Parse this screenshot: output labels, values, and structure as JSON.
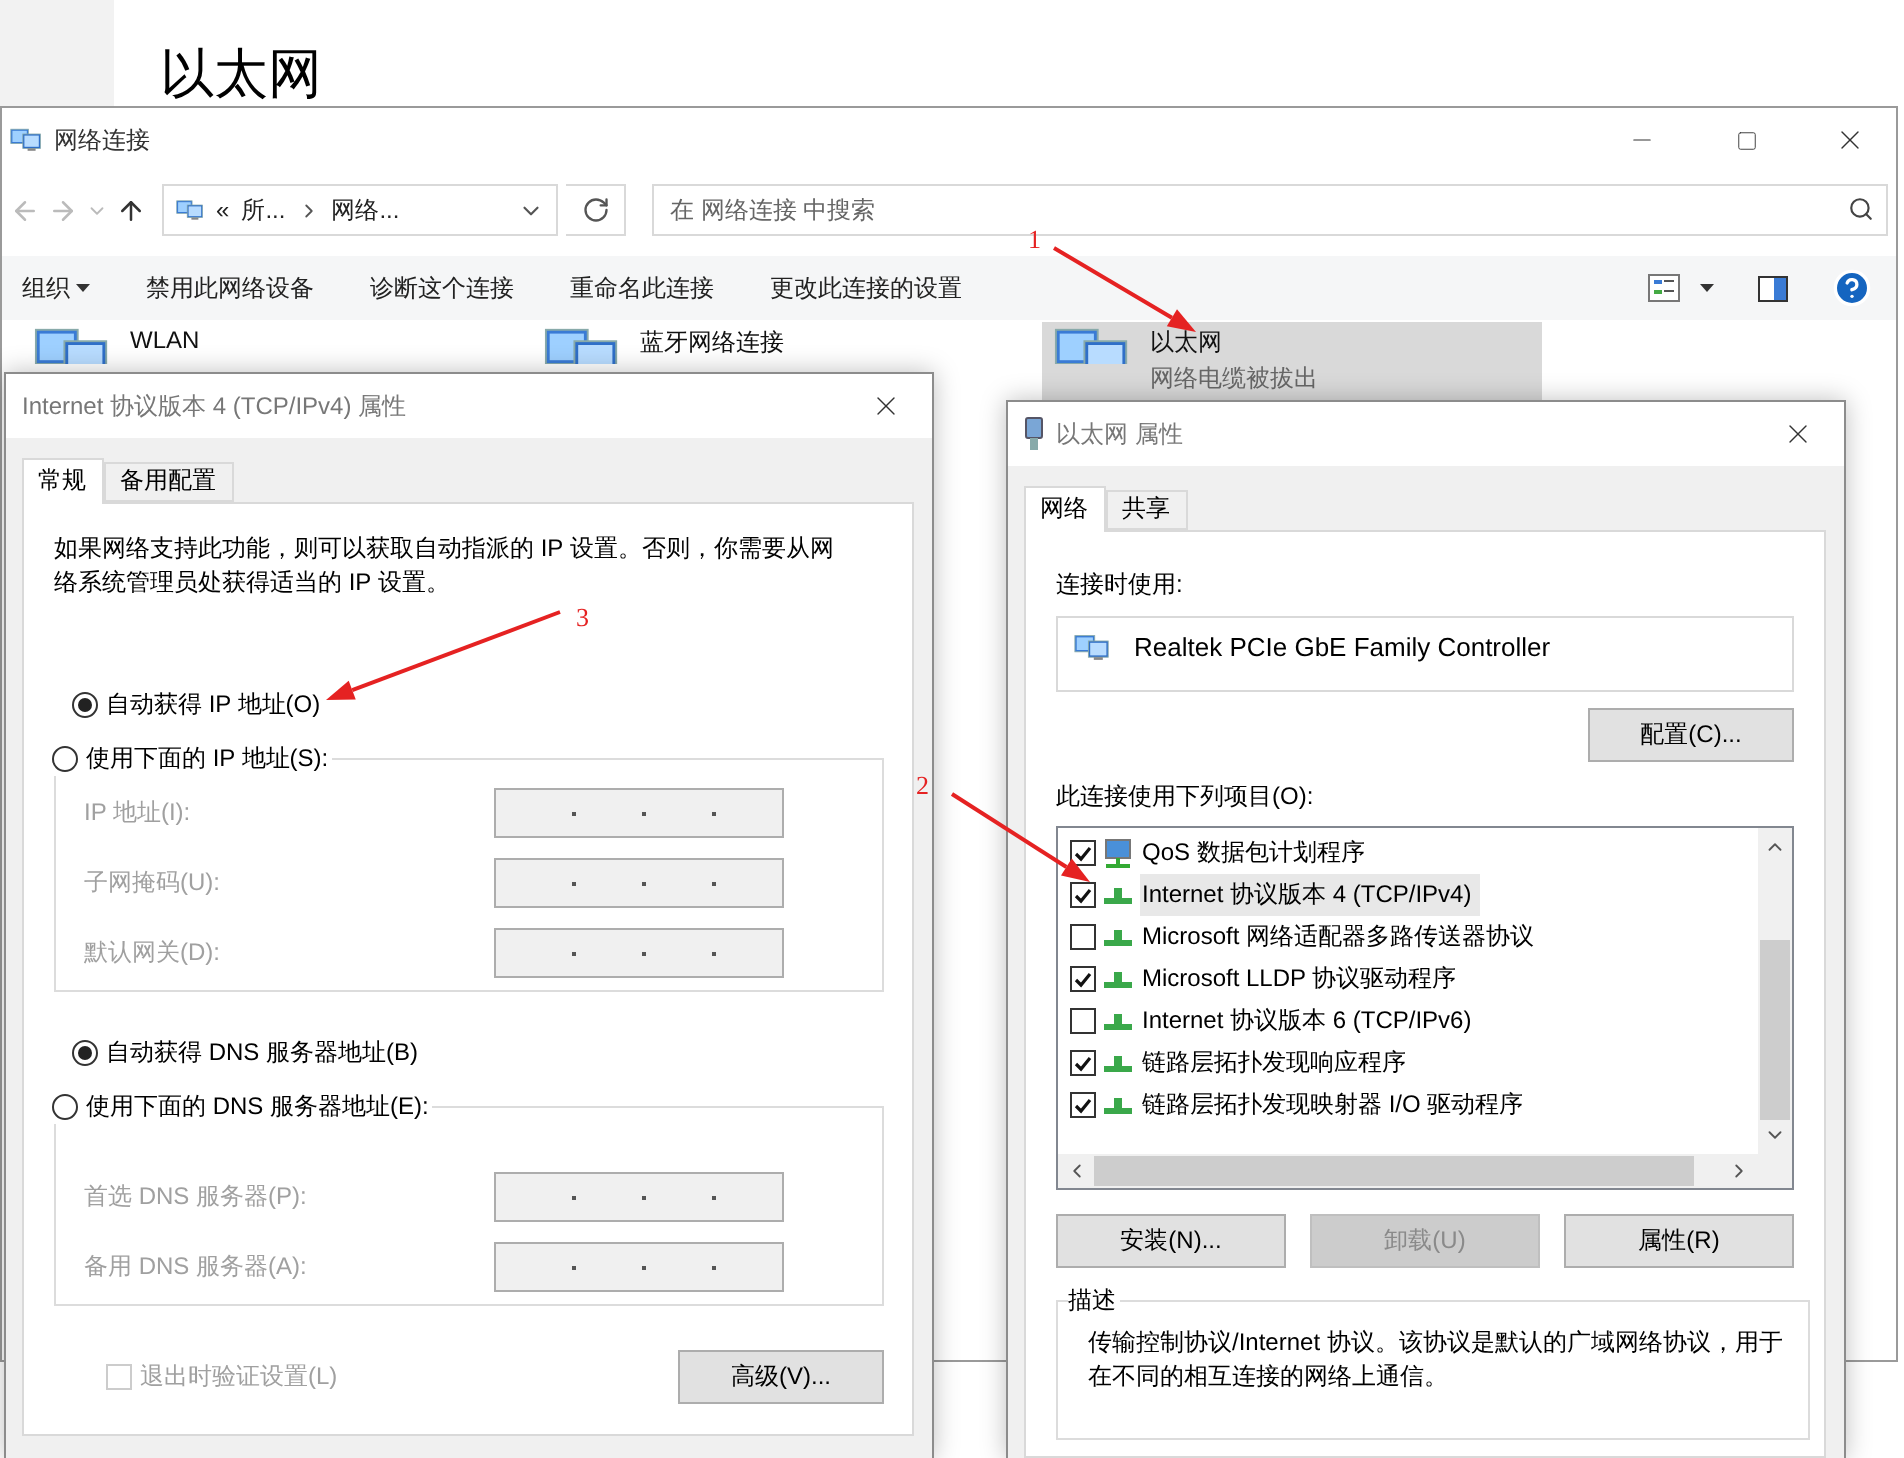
{
  "background_page": {
    "title": "以太网"
  },
  "explorer": {
    "title": "网络连接",
    "breadcrumb": {
      "overflow_mark": "«",
      "parts": [
        "所...",
        "网络..."
      ]
    },
    "search": {
      "placeholder": "在 网络连接 中搜索"
    },
    "toolbar": [
      {
        "label": "组织",
        "kind": "menu"
      },
      {
        "label": "禁用此网络设备",
        "kind": "button"
      },
      {
        "label": "诊断这个连接",
        "kind": "button"
      },
      {
        "label": "重命名此连接",
        "kind": "button"
      },
      {
        "label": "更改此连接的设置",
        "kind": "button"
      }
    ],
    "connections": [
      {
        "name": "WLAN",
        "selected": false
      },
      {
        "name": "蓝牙网络连接",
        "selected": false
      },
      {
        "name": "以太网",
        "status": "网络电缆被拔出",
        "selected": true
      }
    ]
  },
  "ipv4_dialog": {
    "title": "Internet 协议版本 4 (TCP/IPv4) 属性",
    "tabs": [
      {
        "label": "常规",
        "selected": true
      },
      {
        "label": "备用配置",
        "selected": false
      }
    ],
    "intro": "如果网络支持此功能，则可以获取自动指派的 IP 设置。否则，你需要从网络系统管理员处获得适当的 IP 设置。",
    "ip_mode": [
      {
        "label": "自动获得 IP 地址(O)",
        "selected": true
      },
      {
        "label": "使用下面的 IP 地址(S):",
        "selected": false
      }
    ],
    "ip_fields": [
      {
        "label": "IP 地址(I):",
        "disabled": true
      },
      {
        "label": "子网掩码(U):",
        "disabled": true
      },
      {
        "label": "默认网关(D):",
        "disabled": true
      }
    ],
    "dns_mode": [
      {
        "label": "自动获得 DNS 服务器地址(B)",
        "selected": true
      },
      {
        "label": "使用下面的 DNS 服务器地址(E):",
        "selected": false
      }
    ],
    "dns_fields": [
      {
        "label": "首选 DNS 服务器(P):",
        "disabled": true
      },
      {
        "label": "备用 DNS 服务器(A):",
        "disabled": true
      }
    ],
    "validate": {
      "label": "退出时验证设置(L)",
      "checked": false,
      "disabled": true
    },
    "advanced_button": "高级(V)..."
  },
  "adapter_dialog": {
    "title": "以太网 属性",
    "tabs": [
      {
        "label": "网络",
        "selected": true
      },
      {
        "label": "共享",
        "selected": false
      }
    ],
    "connect_using_label": "连接时使用:",
    "adapter": "Realtek PCIe GbE Family Controller",
    "configure_button": "配置(C)...",
    "items_label": "此连接使用下列项目(O):",
    "items": [
      {
        "label": "QoS 数据包计划程序",
        "checked": true,
        "selected": false,
        "kind": "service"
      },
      {
        "label": "Internet 协议版本 4 (TCP/IPv4)",
        "checked": true,
        "selected": true,
        "kind": "protocol"
      },
      {
        "label": "Microsoft 网络适配器多路传送器协议",
        "checked": false,
        "selected": false,
        "kind": "protocol"
      },
      {
        "label": "Microsoft LLDP 协议驱动程序",
        "checked": true,
        "selected": false,
        "kind": "protocol"
      },
      {
        "label": "Internet 协议版本 6 (TCP/IPv6)",
        "checked": false,
        "selected": false,
        "kind": "protocol"
      },
      {
        "label": "链路层拓扑发现响应程序",
        "checked": true,
        "selected": false,
        "kind": "protocol"
      },
      {
        "label": "链路层拓扑发现映射器 I/O 驱动程序",
        "checked": true,
        "selected": false,
        "kind": "protocol"
      }
    ],
    "buttons": [
      {
        "label": "安装(N)...",
        "disabled": false
      },
      {
        "label": "卸载(U)",
        "disabled": true
      },
      {
        "label": "属性(R)",
        "disabled": false
      }
    ],
    "description": {
      "title": "描述",
      "text": "传输控制协议/Internet 协议。该协议是默认的广域网络协议，用于在不同的相互连接的网络上通信。"
    }
  },
  "annotations": [
    {
      "label": "1"
    },
    {
      "label": "2"
    },
    {
      "label": "3"
    }
  ]
}
